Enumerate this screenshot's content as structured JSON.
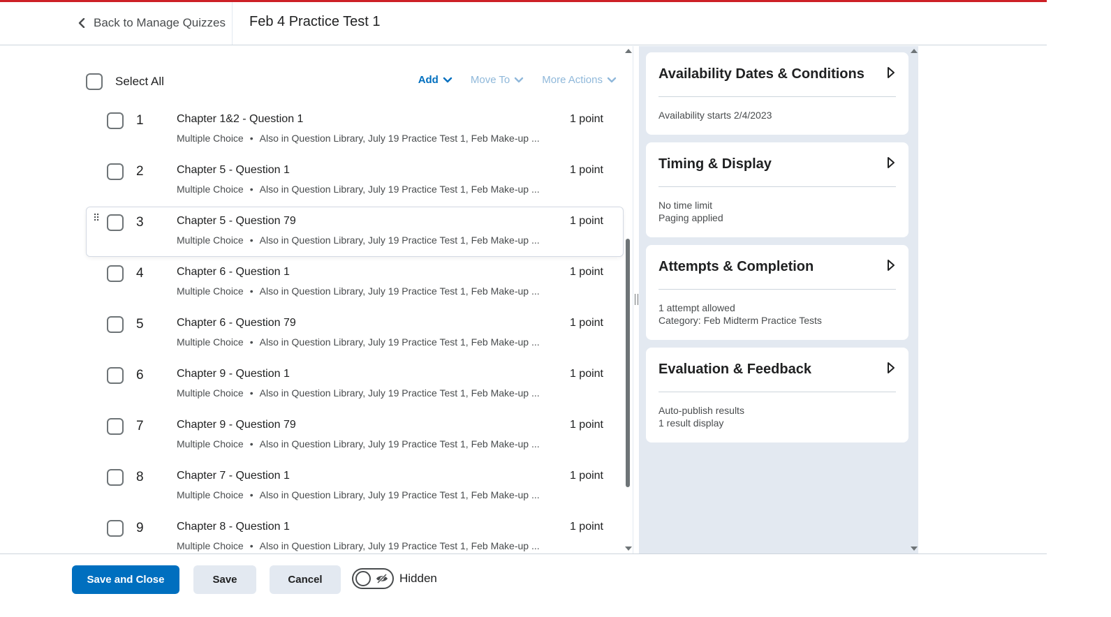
{
  "header": {
    "back_label": "Back to Manage Quizzes",
    "title": "Feb 4 Practice Test 1"
  },
  "toolbar": {
    "select_all_label": "Select All",
    "add_label": "Add",
    "move_to_label": "Move To",
    "more_actions_label": "More Actions"
  },
  "questions": [
    {
      "num": "1",
      "title": "Chapter 1&2 - Question 1",
      "type": "Multiple Choice",
      "also_in": "Also in Question Library, July 19 Practice Test 1, Feb Make-up ...",
      "points": "1 point"
    },
    {
      "num": "2",
      "title": "Chapter 5 - Question 1",
      "type": "Multiple Choice",
      "also_in": "Also in Question Library, July 19 Practice Test 1, Feb Make-up ...",
      "points": "1 point"
    },
    {
      "num": "3",
      "title": "Chapter 5 - Question 79",
      "type": "Multiple Choice",
      "also_in": "Also in Question Library, July 19 Practice Test 1, Feb Make-up ...",
      "points": "1 point"
    },
    {
      "num": "4",
      "title": "Chapter 6 - Question 1",
      "type": "Multiple Choice",
      "also_in": "Also in Question Library, July 19 Practice Test 1, Feb Make-up ...",
      "points": "1 point"
    },
    {
      "num": "5",
      "title": "Chapter 6 - Question 79",
      "type": "Multiple Choice",
      "also_in": "Also in Question Library, July 19 Practice Test 1, Feb Make-up ...",
      "points": "1 point"
    },
    {
      "num": "6",
      "title": "Chapter 9 - Question 1",
      "type": "Multiple Choice",
      "also_in": "Also in Question Library, July 19 Practice Test 1, Feb Make-up ...",
      "points": "1 point"
    },
    {
      "num": "7",
      "title": "Chapter 9 - Question 79",
      "type": "Multiple Choice",
      "also_in": "Also in Question Library, July 19 Practice Test 1, Feb Make-up ...",
      "points": "1 point"
    },
    {
      "num": "8",
      "title": "Chapter 7 - Question 1",
      "type": "Multiple Choice",
      "also_in": "Also in Question Library, July 19 Practice Test 1, Feb Make-up ...",
      "points": "1 point"
    },
    {
      "num": "9",
      "title": "Chapter 8 - Question 1",
      "type": "Multiple Choice",
      "also_in": "Also in Question Library, July 19 Practice Test 1, Feb Make-up ...",
      "points": "1 point"
    }
  ],
  "sidebar": {
    "cards": [
      {
        "title": "Availability Dates & Conditions",
        "lines": [
          "Availability starts 2/4/2023"
        ]
      },
      {
        "title": "Timing & Display",
        "lines": [
          "No time limit",
          "Paging applied"
        ]
      },
      {
        "title": "Attempts & Completion",
        "lines": [
          "1 attempt allowed",
          "Category: Feb Midterm Practice Tests"
        ]
      },
      {
        "title": "Evaluation & Feedback",
        "lines": [
          "Auto-publish results",
          "1 result display"
        ]
      }
    ]
  },
  "footer": {
    "save_close_label": "Save and Close",
    "save_label": "Save",
    "cancel_label": "Cancel",
    "visibility_label": "Hidden"
  },
  "colors": {
    "accent_red": "#cd2026",
    "primary_blue": "#006fbf",
    "sidebar_bg": "#e3e9f1"
  },
  "icons": {
    "back": "chevron-left-icon",
    "dropdown": "chevron-down-icon",
    "drag": "drag-handle-icon",
    "expand": "triangle-right-icon",
    "visibility": "eye-off-icon"
  }
}
